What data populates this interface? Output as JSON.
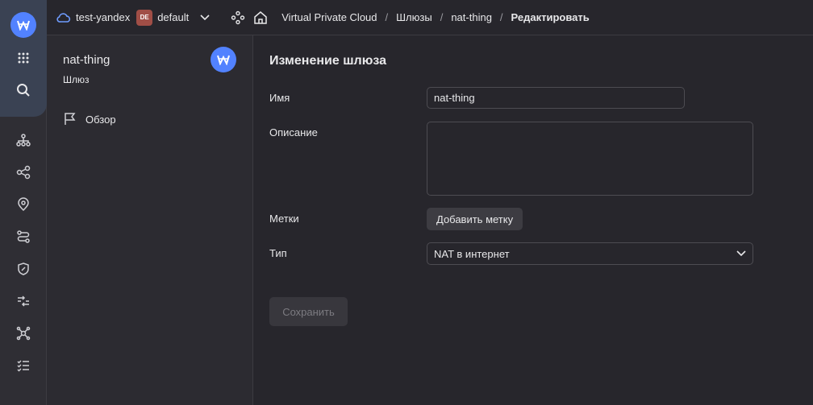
{
  "header": {
    "cloud_name": "test-yandex",
    "folder_badge": "DE",
    "folder_name": "default",
    "breadcrumbs": [
      "Virtual Private Cloud",
      "Шлюзы",
      "nat-thing",
      "Редактировать"
    ]
  },
  "sidebar": {
    "title": "nat-thing",
    "subtitle": "Шлюз",
    "nav_items": [
      {
        "label": "Обзор"
      }
    ]
  },
  "form": {
    "title": "Изменение шлюза",
    "name_label": "Имя",
    "name_value": "nat-thing",
    "description_label": "Описание",
    "description_value": "",
    "labels_label": "Метки",
    "add_label_button": "Добавить метку",
    "type_label": "Тип",
    "type_value": "NAT в интернет",
    "save_button": "Сохранить"
  },
  "colors": {
    "accent": "#5282ff",
    "badge": "#a04e46"
  }
}
